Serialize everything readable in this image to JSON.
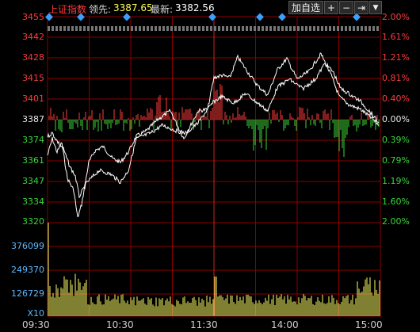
{
  "header": {
    "index_name": "上证指数",
    "lead_label": "领先:",
    "lead_value": "3387.65",
    "latest_label": "最新:",
    "latest_value": "3382.56",
    "add_watch_label": "加自选"
  },
  "price_axis_left": [
    "3455",
    "3442",
    "3428",
    "3415",
    "3401",
    "3387",
    "3374",
    "3361",
    "3347",
    "3334",
    "3320"
  ],
  "price_axis_right": [
    "2.00%",
    "1.61%",
    "1.21%",
    "0.81%",
    "0.40%",
    "0.00%",
    "0.39%",
    "0.79%",
    "1.19%",
    "1.60%",
    "2.00%"
  ],
  "volume_axis": [
    "376099",
    "249370",
    "126729",
    "X10"
  ],
  "time_axis": [
    "09:30",
    "10:30",
    "11:30",
    "14:00",
    "15:00"
  ],
  "colors": {
    "up": "#ff3b3b",
    "down": "#39d839",
    "grid": "#8b0000",
    "volume": "#ffff66"
  }
}
